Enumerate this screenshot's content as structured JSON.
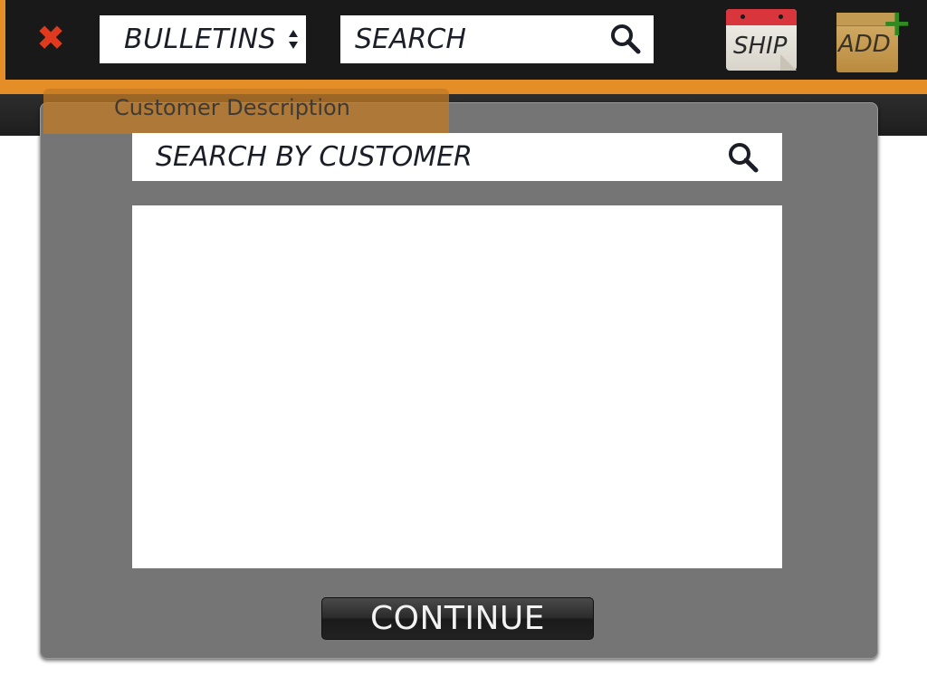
{
  "toolbar": {
    "close_glyph": "✖",
    "bulletins_select": {
      "selected": "BULLETINS"
    },
    "search": {
      "placeholder": "SEARCH",
      "value": ""
    },
    "ship_label": "SHIP",
    "add_label": "ADD",
    "add_glyph": "+"
  },
  "modal": {
    "tab_label": "Customer Description",
    "customer_search": {
      "placeholder": "SEARCH BY CUSTOMER",
      "value": ""
    },
    "results": [],
    "continue_label": "CONTINUE"
  },
  "colors": {
    "toolbar_bg": "#191919",
    "accent_orange": "#e58d26",
    "close_red": "#e03a1e",
    "modal_bg": "#757575",
    "add_green": "#2f8a1f",
    "calendar_red": "#d8363c"
  },
  "icons": [
    "close-icon",
    "select-arrows-icon",
    "search-icon",
    "calendar-icon",
    "shopping-bag-icon",
    "plus-icon"
  ]
}
